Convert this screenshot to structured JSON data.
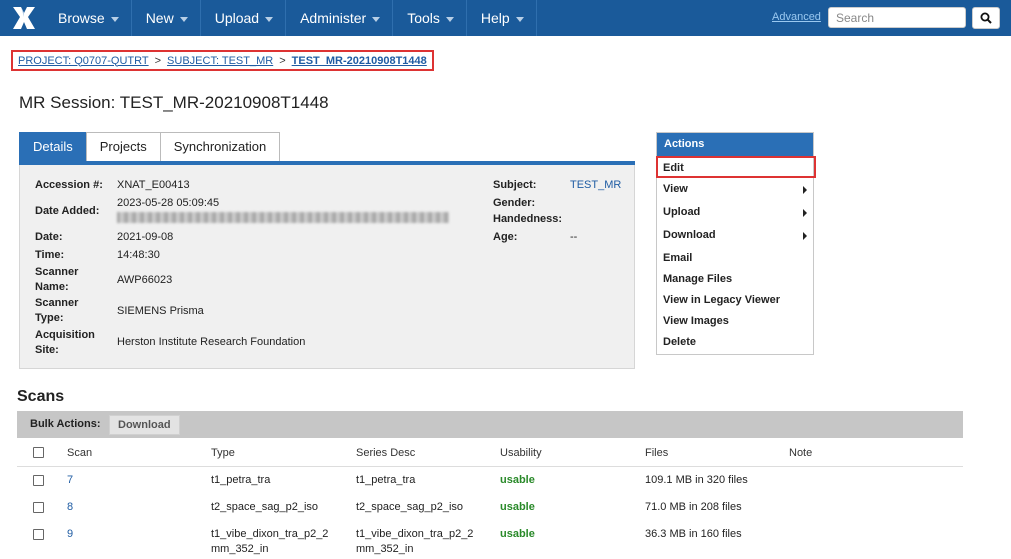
{
  "nav": {
    "logo": "xnat-logo-icon",
    "items": [
      {
        "label": "Browse"
      },
      {
        "label": "New"
      },
      {
        "label": "Upload"
      },
      {
        "label": "Administer"
      },
      {
        "label": "Tools"
      },
      {
        "label": "Help"
      }
    ],
    "advanced_label": "Advanced",
    "search_placeholder": "Search"
  },
  "breadcrumb": {
    "project": "PROJECT: Q0707-QUTRT",
    "subject": "SUBJECT: TEST_MR",
    "session": "TEST_MR-20210908T1448",
    "separator": ">"
  },
  "page_title": "MR Session: TEST_MR-20210908T1448",
  "tabs": [
    {
      "label": "Details",
      "active": true
    },
    {
      "label": "Projects",
      "active": false
    },
    {
      "label": "Synchronization",
      "active": false
    }
  ],
  "details": {
    "accession_label": "Accession #:",
    "accession_value": "XNAT_E00413",
    "date_added_label": "Date Added:",
    "date_added_value": "2023-05-28 05:09:45",
    "date_label": "Date:",
    "date_value": "2021-09-08",
    "time_label": "Time:",
    "time_value": "14:48:30",
    "scanner_name_label_1": "Scanner",
    "scanner_name_label_2": "Name:",
    "scanner_name_value": "AWP66023",
    "scanner_type_label_1": "Scanner",
    "scanner_type_label_2": "Type:",
    "scanner_type_value": "SIEMENS Prisma",
    "acq_site_label_1": "Acquisition",
    "acq_site_label_2": "Site:",
    "acq_site_value": "Herston Institute Research Foundation",
    "subject_label": "Subject:",
    "subject_value": "TEST_MR",
    "gender_label": "Gender:",
    "handedness_label": "Handedness:",
    "age_label": "Age:",
    "age_value": "--"
  },
  "actions": {
    "header": "Actions",
    "items": {
      "edit": "Edit",
      "view": "View",
      "upload": "Upload",
      "download": "Download",
      "email": "Email",
      "manage_files": "Manage Files",
      "legacy_viewer": "View in Legacy Viewer",
      "view_images": "View Images",
      "delete": "Delete"
    }
  },
  "scans": {
    "title": "Scans",
    "bulk_label": "Bulk Actions:",
    "bulk_download": "Download",
    "columns": {
      "scan": "Scan",
      "type": "Type",
      "series_desc": "Series Desc",
      "usability": "Usability",
      "files": "Files",
      "note": "Note"
    },
    "rows": [
      {
        "scan": "7",
        "type_1": "t1_petra_tra",
        "type_2": "",
        "desc_1": "t1_petra_tra",
        "desc_2": "",
        "usability": "usable",
        "files": "109.1 MB in 320 files"
      },
      {
        "scan": "8",
        "type_1": "t2_space_sag_p2_iso",
        "type_2": "",
        "desc_1": "t2_space_sag_p2_iso",
        "desc_2": "",
        "usability": "usable",
        "files": "71.0 MB in 208 files"
      },
      {
        "scan": "9",
        "type_1": "t1_vibe_dixon_tra_p2_2",
        "type_2": "mm_352_in",
        "desc_1": "t1_vibe_dixon_tra_p2_2",
        "desc_2": "mm_352_in",
        "usability": "usable",
        "files": "36.3 MB in 160 files"
      }
    ]
  },
  "colors": {
    "nav_bg": "#1a5a9a",
    "accent": "#2a6fb6",
    "link": "#1f5ca3",
    "usable": "#2a8a2a",
    "highlight_border": "#d33"
  }
}
